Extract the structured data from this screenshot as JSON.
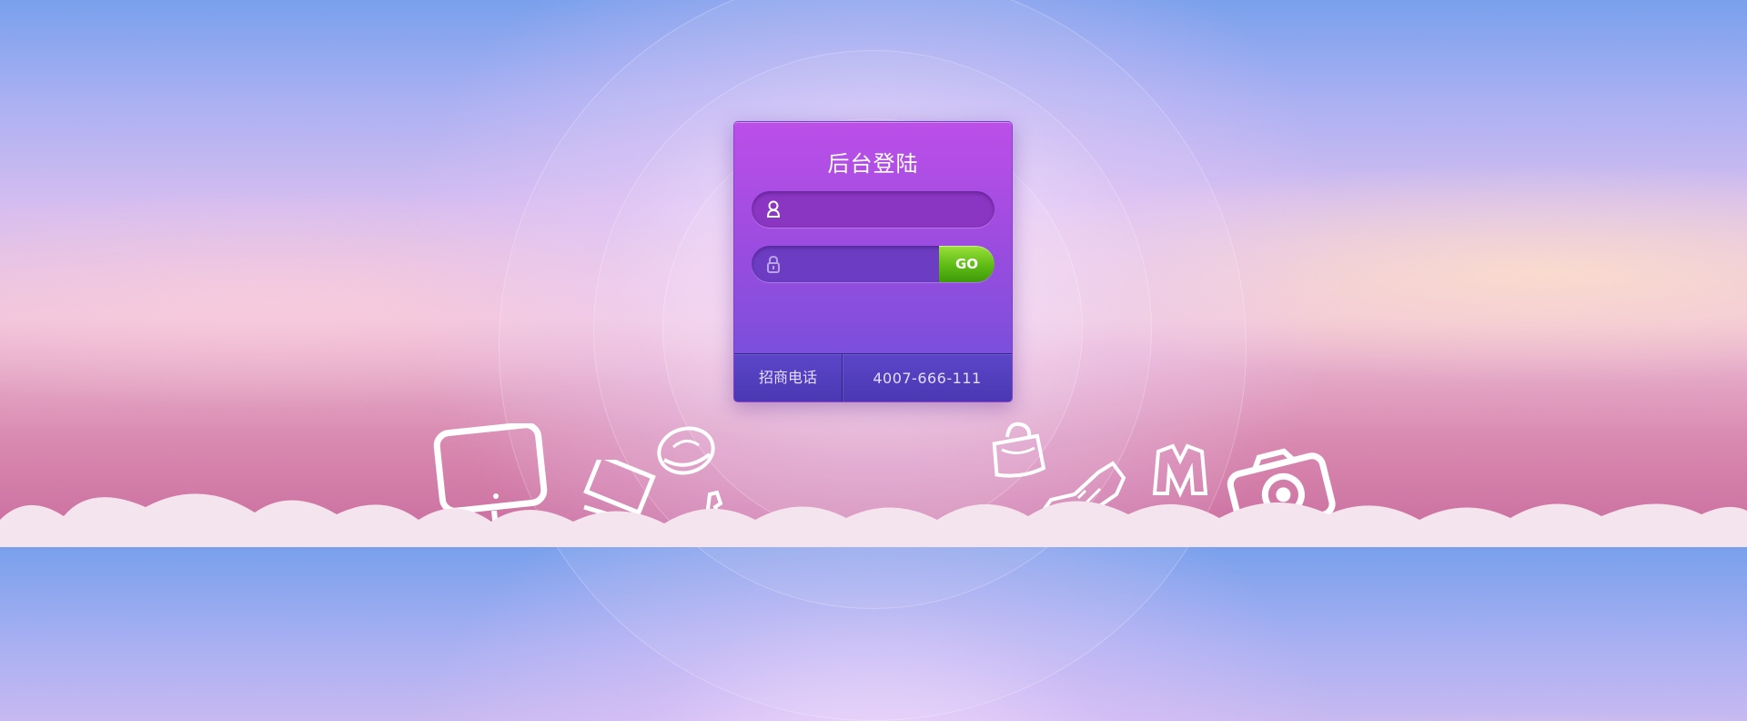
{
  "login": {
    "title": "后台登陆",
    "username_placeholder": "",
    "password_placeholder": "",
    "submit_label": "GO"
  },
  "footer": {
    "label": "招商电话",
    "phone": "4007-666-111"
  },
  "colors": {
    "panel_top": "#bc4fe8",
    "panel_bottom": "#6d50da",
    "go_button": "#5dbb14",
    "footer": "#4a38b2"
  },
  "icons": [
    "user-icon",
    "lock-icon",
    "monitor-icon",
    "laptop-icon",
    "hat-icon",
    "phone-icon",
    "handbag-icon",
    "sneaker-icon",
    "suit-icon",
    "camera-icon"
  ]
}
